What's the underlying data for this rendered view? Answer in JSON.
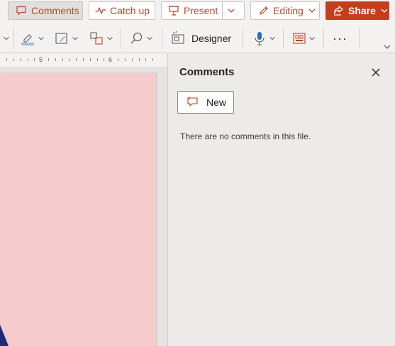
{
  "topbar": {
    "comments_label": "Comments",
    "catchup_label": "Catch up",
    "present_label": "Present",
    "editing_label": "Editing",
    "share_label": "Share"
  },
  "ribbon": {
    "designer_label": "Designer",
    "more_label": "···"
  },
  "ruler": {
    "marks": [
      "5",
      "6"
    ]
  },
  "comments_pane": {
    "title": "Comments",
    "new_label": "New",
    "empty_message": "There are no comments in this file."
  },
  "colors": {
    "accent": "#c43e1c",
    "accent_text": "#b7472a",
    "slide_background": "#f6cbce",
    "pane_background": "#edebe9"
  },
  "icons": [
    "comment-icon",
    "catch-up-icon",
    "present-icon",
    "chevron-down-icon",
    "pencil-icon",
    "share-icon",
    "close-icon",
    "new-comment-icon",
    "find-icon",
    "designer-icon",
    "dictate-icon",
    "layout-icon",
    "arrange-icon",
    "shape-fill-icon",
    "shape-outline-icon"
  ]
}
